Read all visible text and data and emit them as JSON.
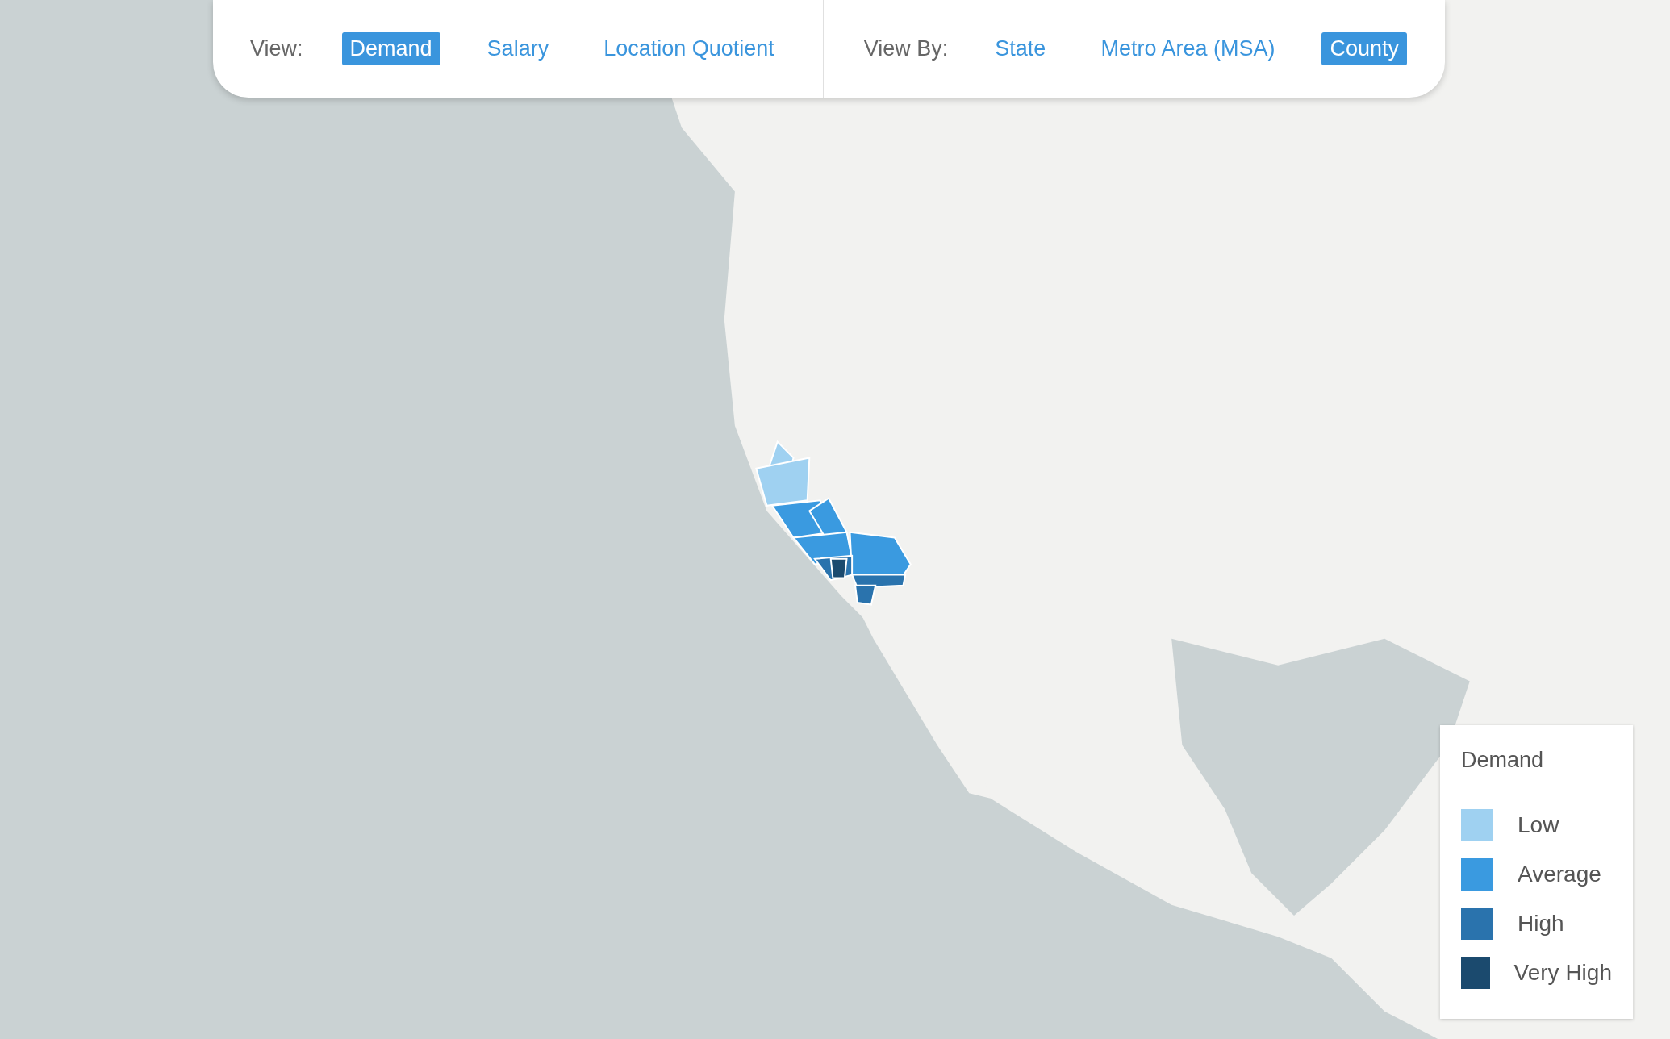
{
  "toolbar": {
    "view_label": "View:",
    "view_options": [
      {
        "label": "Demand",
        "selected": true
      },
      {
        "label": "Salary",
        "selected": false
      },
      {
        "label": "Location Quotient",
        "selected": false
      }
    ],
    "view_by_label": "View By:",
    "view_by_options": [
      {
        "label": "State",
        "selected": false
      },
      {
        "label": "Metro Area (MSA)",
        "selected": false
      },
      {
        "label": "County",
        "selected": true
      }
    ]
  },
  "legend": {
    "title": "Demand",
    "items": [
      {
        "label": "Low",
        "color": "#9fd1f1"
      },
      {
        "label": "Average",
        "color": "#3a9ae0"
      },
      {
        "label": "High",
        "color": "#2a73ad"
      },
      {
        "label": "Very High",
        "color": "#1b4a6e"
      }
    ]
  }
}
